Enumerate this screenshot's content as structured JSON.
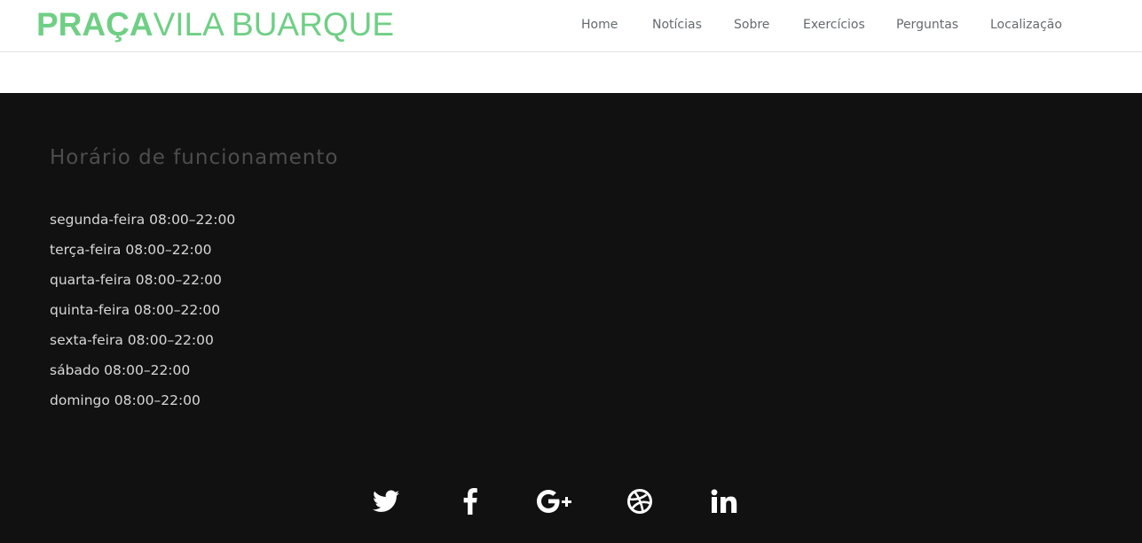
{
  "header": {
    "logo_bold": "PRAÇA",
    "logo_light": "VILA BUARQUE",
    "nav": [
      "Home",
      "Notícias",
      "Sobre",
      "Exercícios",
      "Perguntas",
      "Localização"
    ]
  },
  "footer": {
    "hours_title": "Horário de funcionamento",
    "hours": [
      "segunda-feira 08:00–22:00",
      "terça-feira 08:00–22:00",
      "quarta-feira 08:00–22:00",
      "quinta-feira 08:00–22:00",
      "sexta-feira 08:00–22:00",
      "sábado 08:00–22:00",
      "domingo 08:00–22:00"
    ],
    "social_icons": [
      "twitter-icon",
      "facebook-icon",
      "google-plus-icon",
      "dribbble-icon",
      "linkedin-icon"
    ]
  },
  "colors": {
    "brand": "#6fcf85",
    "footer_bg": "#111111",
    "nav_text": "#666a6e"
  }
}
